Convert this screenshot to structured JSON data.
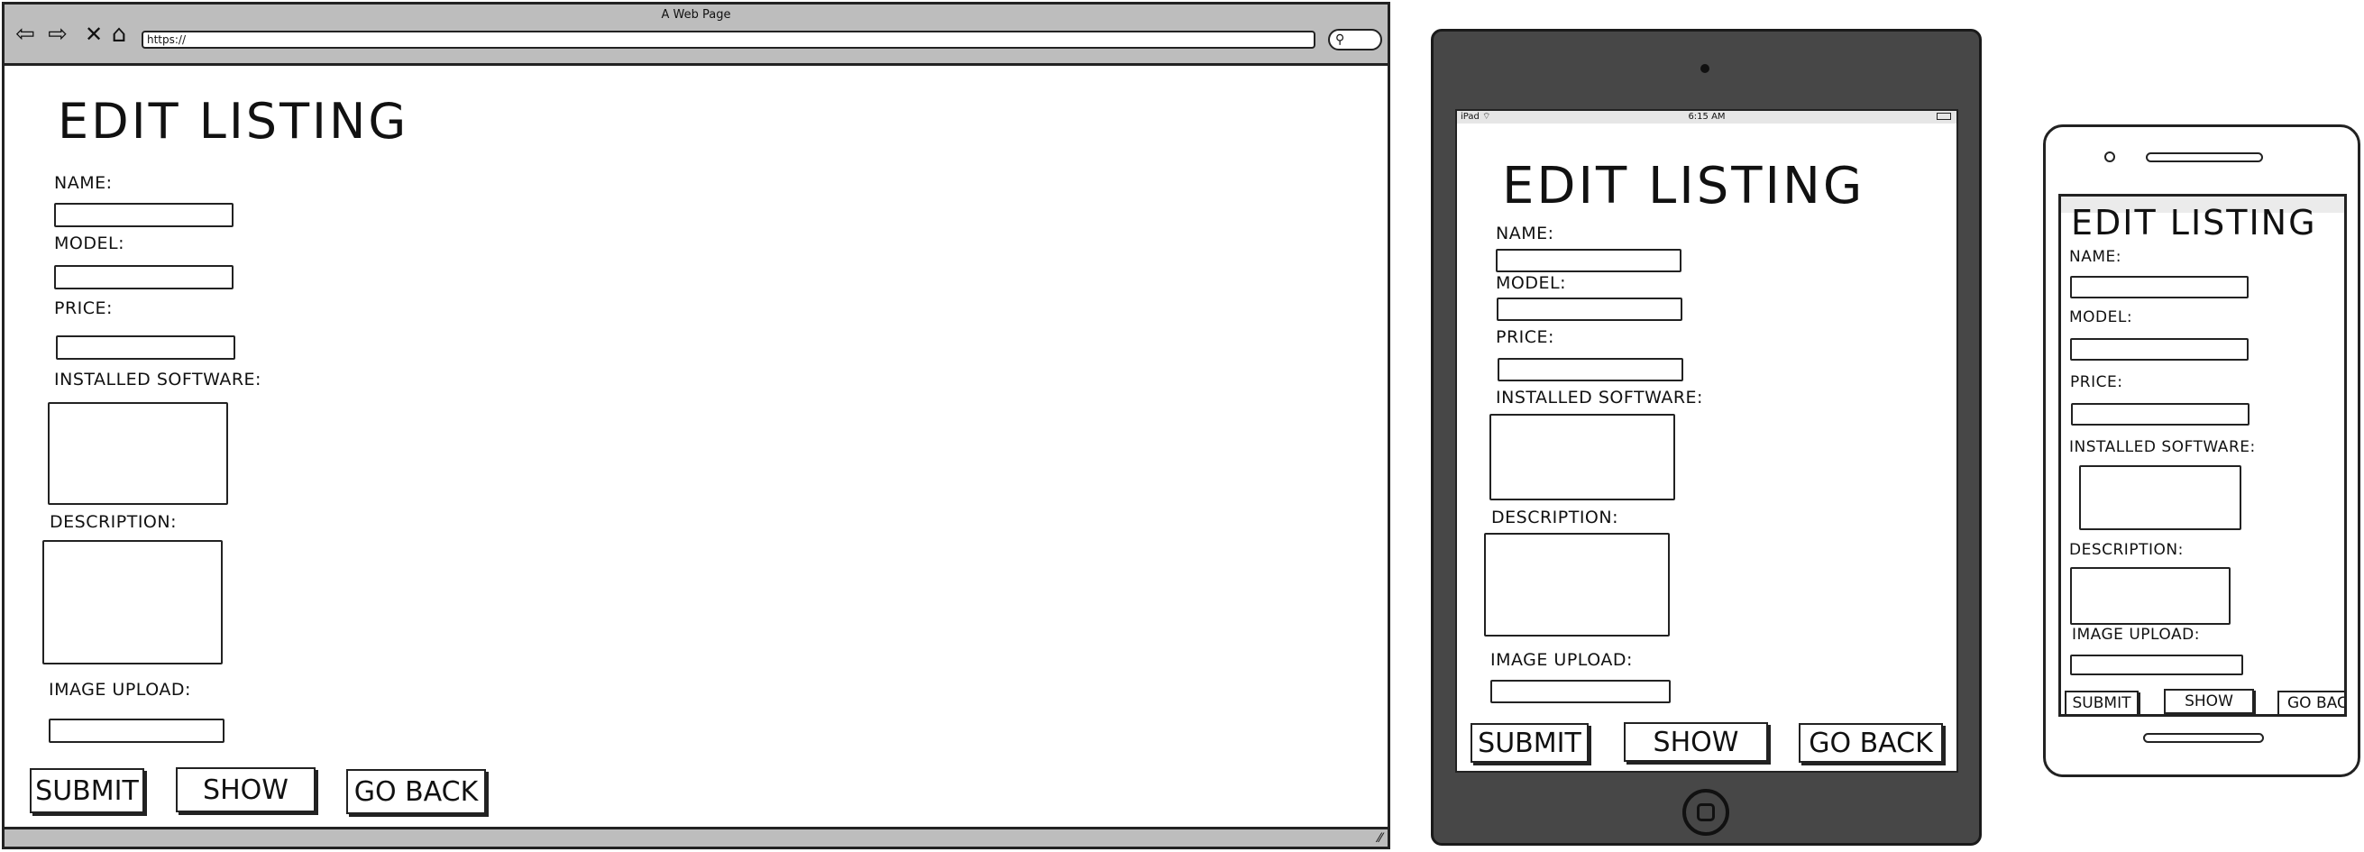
{
  "browser": {
    "window_title": "A Web Page",
    "url": "https://",
    "icons": {
      "back": "back-arrow-icon",
      "forward": "forward-arrow-icon",
      "stop": "stop-x-icon",
      "home": "home-icon",
      "search": "search-icon"
    }
  },
  "tablet": {
    "status_left": "iPad ⌔",
    "status_time": "6:15 AM"
  },
  "form": {
    "title": "EDIT LISTING",
    "name_label": "NAME:",
    "model_label": "MODEL:",
    "price_label": "PRICE:",
    "software_label": "INSTALLED SOFTWARE:",
    "description_label": "DESCRIPTION:",
    "image_label": "IMAGE UPLOAD:",
    "submit": "SUBMIT",
    "show": "SHOW",
    "go_back": "GO BACK"
  },
  "colors": {
    "chrome_gray": "#bdbdbd",
    "tablet_body": "#474747",
    "ink": "#222222"
  }
}
